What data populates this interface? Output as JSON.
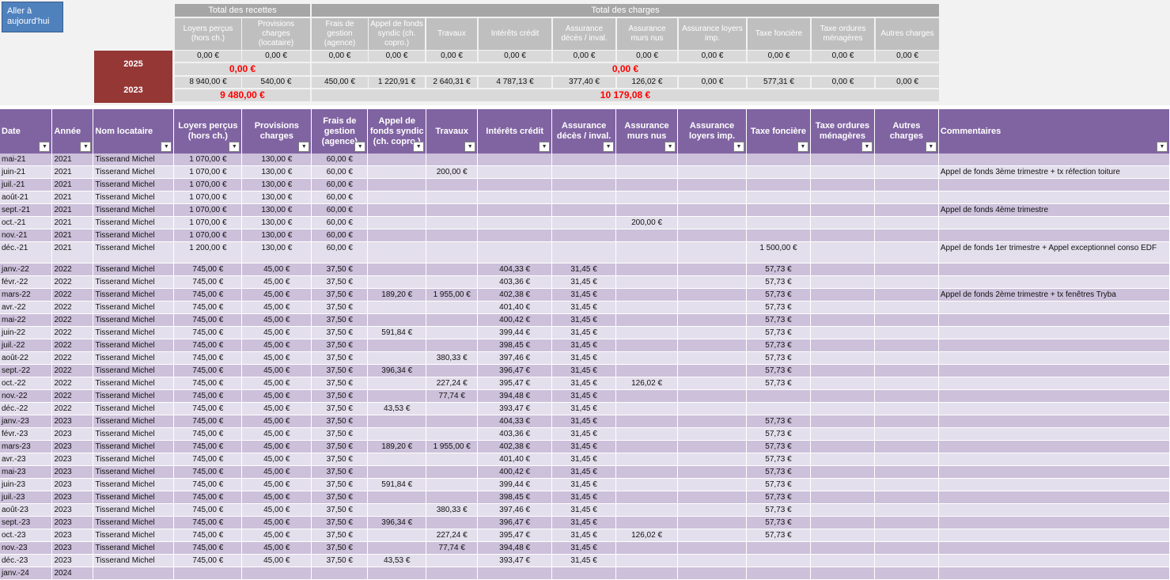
{
  "goto_button": {
    "line1": "Aller à",
    "line2": "aujourd'hui"
  },
  "summary": {
    "recettes_title": "Total des recettes",
    "charges_title": "Total des charges",
    "columns": [
      "Loyers perçus (hors ch.)",
      "Provisions charges (locataire)",
      "Frais de gestion (agence)",
      "Appel de fonds syndic (ch. copro.)",
      "Travaux",
      "Intérêts crédit",
      "Assurance décès / inval.",
      "Assurance murs nus",
      "Assurance loyers imp.",
      "Taxe foncière",
      "Taxe ordures ménagères",
      "Autres charges"
    ],
    "years": [
      {
        "year": "2025",
        "values": [
          "0,00 €",
          "0,00 €",
          "0,00 €",
          "0,00 €",
          "0,00 €",
          "0,00 €",
          "0,00 €",
          "0,00 €",
          "0,00 €",
          "0,00 €",
          "0,00 €",
          "0,00 €"
        ],
        "total_recettes": "0,00 €",
        "total_charges": "0,00 €"
      },
      {
        "year": "2023",
        "values": [
          "8 940,00 €",
          "540,00 €",
          "450,00 €",
          "1 220,91 €",
          "2 640,31 €",
          "4 787,13 €",
          "377,40 €",
          "126,02 €",
          "0,00 €",
          "577,31 €",
          "0,00 €",
          "0,00 €"
        ],
        "total_recettes": "9 480,00 €",
        "total_charges": "10 179,08 €"
      }
    ]
  },
  "table": {
    "headers": [
      "Date",
      "Année",
      "Nom locataire",
      "Loyers perçus (hors ch.)",
      "Provisions charges",
      "Frais de gestion (agence)",
      "Appel de fonds syndic (ch. copro.)",
      "Travaux",
      "Intérêts crédit",
      "Assurance décès / inval.",
      "Assurance murs nus",
      "Assurance loyers imp.",
      "Taxe foncière",
      "Taxe ordures ménagères",
      "Autres charges",
      "Commentaires"
    ],
    "filter_glyph": "▼",
    "rows": [
      [
        "mai-21",
        "2021",
        "Tisserand Michel",
        "1 070,00 €",
        "130,00 €",
        "60,00 €",
        "",
        "",
        "",
        "",
        "",
        "",
        "",
        "",
        "",
        ""
      ],
      [
        "juin-21",
        "2021",
        "Tisserand Michel",
        "1 070,00 €",
        "130,00 €",
        "60,00 €",
        "",
        "200,00 €",
        "",
        "",
        "",
        "",
        "",
        "",
        "",
        "Appel de fonds 3ème trimestre + tx réfection toiture"
      ],
      [
        "juil.-21",
        "2021",
        "Tisserand Michel",
        "1 070,00 €",
        "130,00 €",
        "60,00 €",
        "",
        "",
        "",
        "",
        "",
        "",
        "",
        "",
        "",
        ""
      ],
      [
        "août-21",
        "2021",
        "Tisserand Michel",
        "1 070,00 €",
        "130,00 €",
        "60,00 €",
        "",
        "",
        "",
        "",
        "",
        "",
        "",
        "",
        "",
        ""
      ],
      [
        "sept.-21",
        "2021",
        "Tisserand Michel",
        "1 070,00 €",
        "130,00 €",
        "60,00 €",
        "",
        "",
        "",
        "",
        "",
        "",
        "",
        "",
        "",
        "Appel de fonds 4ème trimestre"
      ],
      [
        "oct.-21",
        "2021",
        "Tisserand Michel",
        "1 070,00 €",
        "130,00 €",
        "60,00 €",
        "",
        "",
        "",
        "",
        "200,00 €",
        "",
        "",
        "",
        "",
        ""
      ],
      [
        "nov.-21",
        "2021",
        "Tisserand Michel",
        "1 070,00 €",
        "130,00 €",
        "60,00 €",
        "",
        "",
        "",
        "",
        "",
        "",
        "",
        "",
        "",
        ""
      ],
      [
        "déc.-21",
        "2021",
        "Tisserand Michel",
        "1 200,00 €",
        "130,00 €",
        "60,00 €",
        "",
        "",
        "",
        "",
        "",
        "",
        "1 500,00 €",
        "",
        "",
        "Appel de fonds 1er trimestre + Appel exceptionnel conso EDF"
      ],
      [
        "janv.-22",
        "2022",
        "Tisserand Michel",
        "745,00 €",
        "45,00 €",
        "37,50 €",
        "",
        "",
        "404,33 €",
        "31,45 €",
        "",
        "",
        "57,73 €",
        "",
        "",
        ""
      ],
      [
        "févr.-22",
        "2022",
        "Tisserand Michel",
        "745,00 €",
        "45,00 €",
        "37,50 €",
        "",
        "",
        "403,36 €",
        "31,45 €",
        "",
        "",
        "57,73 €",
        "",
        "",
        ""
      ],
      [
        "mars-22",
        "2022",
        "Tisserand Michel",
        "745,00 €",
        "45,00 €",
        "37,50 €",
        "189,20 €",
        "1 955,00 €",
        "402,38 €",
        "31,45 €",
        "",
        "",
        "57,73 €",
        "",
        "",
        "Appel de fonds 2ème trimestre + tx fenêtres Tryba"
      ],
      [
        "avr.-22",
        "2022",
        "Tisserand Michel",
        "745,00 €",
        "45,00 €",
        "37,50 €",
        "",
        "",
        "401,40 €",
        "31,45 €",
        "",
        "",
        "57,73 €",
        "",
        "",
        ""
      ],
      [
        "mai-22",
        "2022",
        "Tisserand Michel",
        "745,00 €",
        "45,00 €",
        "37,50 €",
        "",
        "",
        "400,42 €",
        "31,45 €",
        "",
        "",
        "57,73 €",
        "",
        "",
        ""
      ],
      [
        "juin-22",
        "2022",
        "Tisserand Michel",
        "745,00 €",
        "45,00 €",
        "37,50 €",
        "591,84 €",
        "",
        "399,44 €",
        "31,45 €",
        "",
        "",
        "57,73 €",
        "",
        "",
        ""
      ],
      [
        "juil.-22",
        "2022",
        "Tisserand Michel",
        "745,00 €",
        "45,00 €",
        "37,50 €",
        "",
        "",
        "398,45 €",
        "31,45 €",
        "",
        "",
        "57,73 €",
        "",
        "",
        ""
      ],
      [
        "août-22",
        "2022",
        "Tisserand Michel",
        "745,00 €",
        "45,00 €",
        "37,50 €",
        "",
        "380,33 €",
        "397,46 €",
        "31,45 €",
        "",
        "",
        "57,73 €",
        "",
        "",
        ""
      ],
      [
        "sept.-22",
        "2022",
        "Tisserand Michel",
        "745,00 €",
        "45,00 €",
        "37,50 €",
        "396,34 €",
        "",
        "396,47 €",
        "31,45 €",
        "",
        "",
        "57,73 €",
        "",
        "",
        ""
      ],
      [
        "oct.-22",
        "2022",
        "Tisserand Michel",
        "745,00 €",
        "45,00 €",
        "37,50 €",
        "",
        "227,24 €",
        "395,47 €",
        "31,45 €",
        "126,02 €",
        "",
        "57,73 €",
        "",
        "",
        ""
      ],
      [
        "nov.-22",
        "2022",
        "Tisserand Michel",
        "745,00 €",
        "45,00 €",
        "37,50 €",
        "",
        "77,74 €",
        "394,48 €",
        "31,45 €",
        "",
        "",
        "",
        "",
        "",
        ""
      ],
      [
        "déc.-22",
        "2022",
        "Tisserand Michel",
        "745,00 €",
        "45,00 €",
        "37,50 €",
        "43,53 €",
        "",
        "393,47 €",
        "31,45 €",
        "",
        "",
        "",
        "",
        "",
        ""
      ],
      [
        "janv.-23",
        "2023",
        "Tisserand Michel",
        "745,00 €",
        "45,00 €",
        "37,50 €",
        "",
        "",
        "404,33 €",
        "31,45 €",
        "",
        "",
        "57,73 €",
        "",
        "",
        ""
      ],
      [
        "févr.-23",
        "2023",
        "Tisserand Michel",
        "745,00 €",
        "45,00 €",
        "37,50 €",
        "",
        "",
        "403,36 €",
        "31,45 €",
        "",
        "",
        "57,73 €",
        "",
        "",
        ""
      ],
      [
        "mars-23",
        "2023",
        "Tisserand Michel",
        "745,00 €",
        "45,00 €",
        "37,50 €",
        "189,20 €",
        "1 955,00 €",
        "402,38 €",
        "31,45 €",
        "",
        "",
        "57,73 €",
        "",
        "",
        ""
      ],
      [
        "avr.-23",
        "2023",
        "Tisserand Michel",
        "745,00 €",
        "45,00 €",
        "37,50 €",
        "",
        "",
        "401,40 €",
        "31,45 €",
        "",
        "",
        "57,73 €",
        "",
        "",
        ""
      ],
      [
        "mai-23",
        "2023",
        "Tisserand Michel",
        "745,00 €",
        "45,00 €",
        "37,50 €",
        "",
        "",
        "400,42 €",
        "31,45 €",
        "",
        "",
        "57,73 €",
        "",
        "",
        ""
      ],
      [
        "juin-23",
        "2023",
        "Tisserand Michel",
        "745,00 €",
        "45,00 €",
        "37,50 €",
        "591,84 €",
        "",
        "399,44 €",
        "31,45 €",
        "",
        "",
        "57,73 €",
        "",
        "",
        ""
      ],
      [
        "juil.-23",
        "2023",
        "Tisserand Michel",
        "745,00 €",
        "45,00 €",
        "37,50 €",
        "",
        "",
        "398,45 €",
        "31,45 €",
        "",
        "",
        "57,73 €",
        "",
        "",
        ""
      ],
      [
        "août-23",
        "2023",
        "Tisserand Michel",
        "745,00 €",
        "45,00 €",
        "37,50 €",
        "",
        "380,33 €",
        "397,46 €",
        "31,45 €",
        "",
        "",
        "57,73 €",
        "",
        "",
        ""
      ],
      [
        "sept.-23",
        "2023",
        "Tisserand Michel",
        "745,00 €",
        "45,00 €",
        "37,50 €",
        "396,34 €",
        "",
        "396,47 €",
        "31,45 €",
        "",
        "",
        "57,73 €",
        "",
        "",
        ""
      ],
      [
        "oct.-23",
        "2023",
        "Tisserand Michel",
        "745,00 €",
        "45,00 €",
        "37,50 €",
        "",
        "227,24 €",
        "395,47 €",
        "31,45 €",
        "126,02 €",
        "",
        "57,73 €",
        "",
        "",
        ""
      ],
      [
        "nov.-23",
        "2023",
        "Tisserand Michel",
        "745,00 €",
        "45,00 €",
        "37,50 €",
        "",
        "77,74 €",
        "394,48 €",
        "31,45 €",
        "",
        "",
        "",
        "",
        "",
        ""
      ],
      [
        "déc.-23",
        "2023",
        "Tisserand Michel",
        "745,00 €",
        "45,00 €",
        "37,50 €",
        "43,53 €",
        "",
        "393,47 €",
        "31,45 €",
        "",
        "",
        "",
        "",
        "",
        ""
      ],
      [
        "janv.-24",
        "2024",
        "",
        "",
        "",
        "",
        "",
        "",
        "",
        "",
        "",
        "",
        "",
        "",
        "",
        ""
      ]
    ]
  }
}
